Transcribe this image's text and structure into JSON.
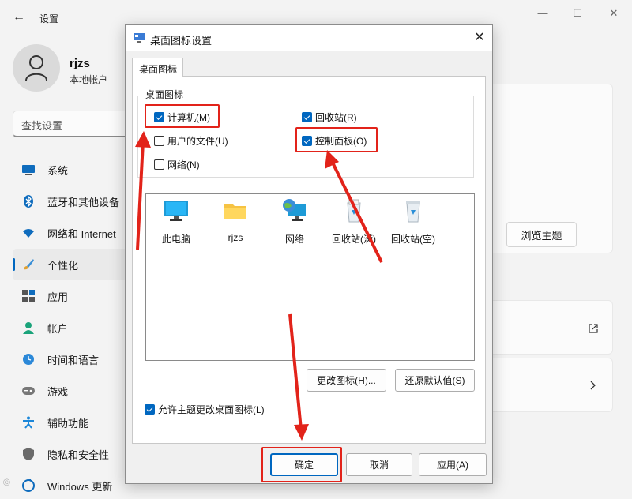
{
  "settings": {
    "app_title": "设置",
    "user": {
      "name": "rjzs",
      "account_type": "本地帐户"
    },
    "search_placeholder": "查找设置",
    "nav": [
      {
        "label": "系统",
        "icon": "monitor-icon"
      },
      {
        "label": "蓝牙和其他设备",
        "icon": "bluetooth-icon"
      },
      {
        "label": "网络和 Internet",
        "icon": "wifi-icon"
      },
      {
        "label": "个性化",
        "icon": "brush-icon",
        "active": true
      },
      {
        "label": "应用",
        "icon": "apps-icon"
      },
      {
        "label": "帐户",
        "icon": "account-icon"
      },
      {
        "label": "时间和语言",
        "icon": "clock-globe-icon"
      },
      {
        "label": "游戏",
        "icon": "gamepad-icon"
      },
      {
        "label": "辅助功能",
        "icon": "accessibility-icon"
      },
      {
        "label": "隐私和安全性",
        "icon": "shield-icon"
      },
      {
        "label": "Windows 更新",
        "icon": "update-icon"
      }
    ],
    "browse_themes_label": "浏览主题"
  },
  "dialog": {
    "title": "桌面图标设置",
    "tab_label": "桌面图标",
    "group_label": "桌面图标",
    "checkboxes": {
      "computer": {
        "label": "计算机(M)",
        "checked": true
      },
      "user_files": {
        "label": "用户的文件(U)",
        "checked": false
      },
      "network": {
        "label": "网络(N)",
        "checked": false
      },
      "recycle_bin": {
        "label": "回收站(R)",
        "checked": true
      },
      "control_panel": {
        "label": "控制面板(O)",
        "checked": true
      }
    },
    "icons": [
      {
        "label": "此电脑",
        "icon": "monitor-icon"
      },
      {
        "label": "rjzs",
        "icon": "folder-icon"
      },
      {
        "label": "网络",
        "icon": "network-globe-icon"
      },
      {
        "label": "回收站(满)",
        "icon": "recycle-bin-full-icon"
      },
      {
        "label": "回收站(空)",
        "icon": "recycle-bin-empty-icon"
      }
    ],
    "change_icon_label": "更改图标(H)...",
    "restore_default_label": "还原默认值(S)",
    "allow_theme_label": "允许主题更改桌面图标(L)",
    "allow_theme_checked": true,
    "ok_label": "确定",
    "cancel_label": "取消",
    "apply_label": "应用(A)"
  },
  "colors": {
    "accent": "#0067c0",
    "annotation_red": "#e2231a"
  }
}
